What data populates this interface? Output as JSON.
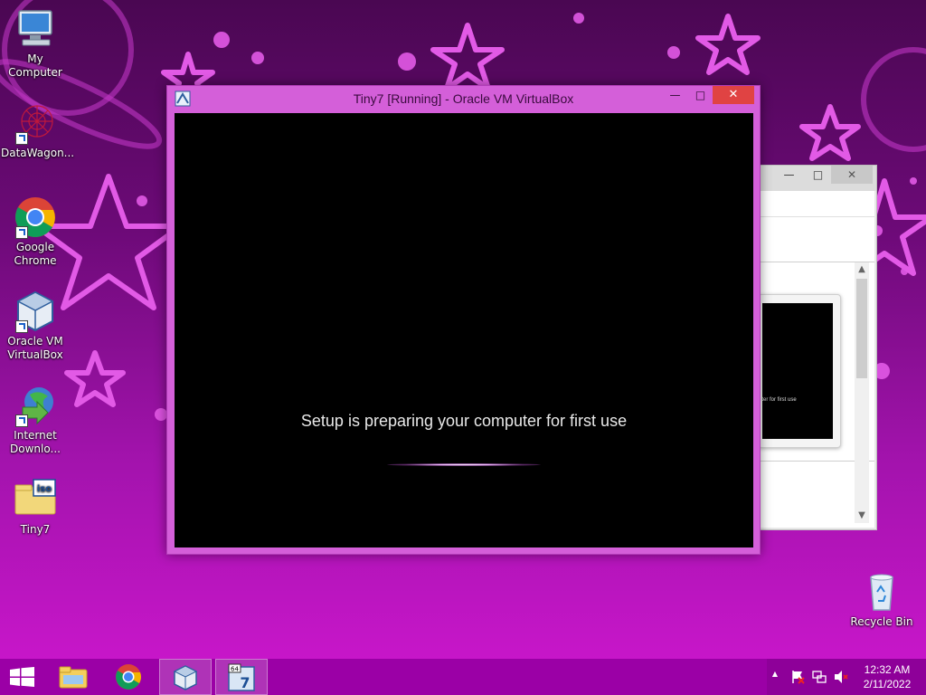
{
  "desktop": {
    "icons": [
      {
        "label": "My Computer",
        "icon": "computer-icon"
      },
      {
        "label": "DataWagon...",
        "icon": "datawagon-icon"
      },
      {
        "label": "Google Chrome",
        "icon": "chrome-icon"
      },
      {
        "label": "Oracle VM VirtualBox",
        "icon": "virtualbox-icon"
      },
      {
        "label": "Internet Downlo...",
        "icon": "internet-download-manager-icon"
      },
      {
        "label": "Tiny7",
        "icon": "iso-file-icon"
      },
      {
        "label": "Recycle Bin",
        "icon": "recycle-bin-icon"
      }
    ]
  },
  "vbox_window": {
    "title": "Tiny7 [Running] - Oracle VM VirtualBox",
    "minimize_glyph": "—",
    "maximize_glyph": "□",
    "close_glyph": "✕",
    "guest_message": "Setup is preparing your computer for first use"
  },
  "bg_window": {
    "minimize_glyph": "—",
    "maximize_glyph": "□",
    "close_glyph": "✕",
    "thumbnail_text": "uter for first use"
  },
  "taskbar": {
    "pinned": [
      {
        "icon": "windows-start-icon"
      },
      {
        "icon": "file-explorer-icon"
      },
      {
        "icon": "chrome-icon"
      },
      {
        "icon": "virtualbox-icon",
        "active": true
      },
      {
        "icon": "tiny7-vm-icon",
        "active": true
      }
    ],
    "tray": {
      "show_hidden_glyph": "▲",
      "time": "12:32 AM",
      "date": "2/11/2022"
    }
  },
  "colors": {
    "desktop_bg_dark": "#4a0752",
    "desktop_bg_light": "#c716c9",
    "window_frame": "#d45fd9",
    "taskbar": "#9b00a6",
    "close_button": "#e04343"
  }
}
